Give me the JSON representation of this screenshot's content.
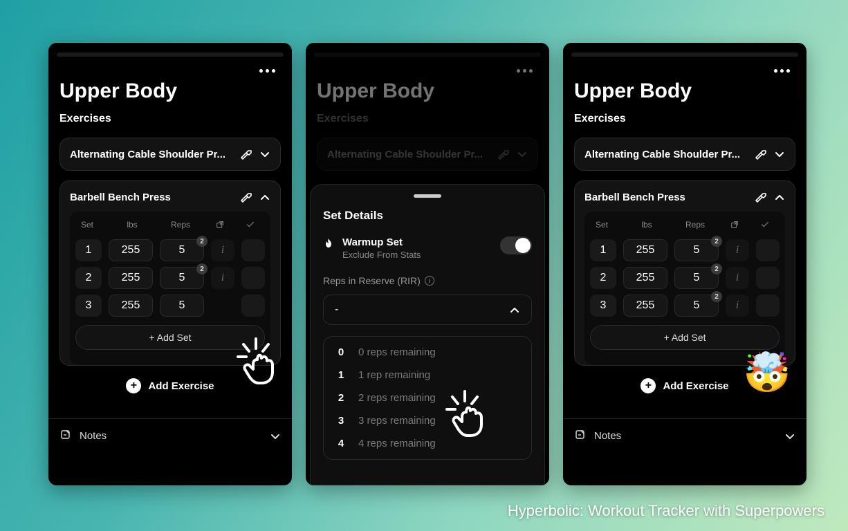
{
  "caption": "Hyperbolic: Workout Tracker with Superpowers",
  "common": {
    "title": "Upper Body",
    "section_label": "Exercises",
    "exercise1_name": "Alternating Cable Shoulder Pr...",
    "exercise2_name": "Barbell Bench Press",
    "headers": {
      "set": "Set",
      "lbs": "lbs",
      "reps": "Reps"
    },
    "add_set": "+ Add Set",
    "add_exercise": "Add Exercise",
    "notes": "Notes"
  },
  "phone1": {
    "sets": [
      {
        "n": "1",
        "lbs": "255",
        "reps": "5",
        "badge": "2"
      },
      {
        "n": "2",
        "lbs": "255",
        "reps": "5",
        "badge": "2"
      },
      {
        "n": "3",
        "lbs": "255",
        "reps": "5"
      }
    ]
  },
  "phone2": {
    "sheet_title": "Set Details",
    "warmup_title": "Warmup Set",
    "warmup_sub": "Exclude From Stats",
    "rir_label": "Reps in Reserve (RIR)",
    "select_value": "-",
    "options": [
      {
        "num": "0",
        "desc": "0 reps remaining"
      },
      {
        "num": "1",
        "desc": "1 rep remaining"
      },
      {
        "num": "2",
        "desc": "2 reps remaining"
      },
      {
        "num": "3",
        "desc": "3 reps remaining"
      },
      {
        "num": "4",
        "desc": "4 reps remaining"
      }
    ]
  },
  "phone3": {
    "sets": [
      {
        "n": "1",
        "lbs": "255",
        "reps": "5",
        "badge": "2"
      },
      {
        "n": "2",
        "lbs": "255",
        "reps": "5",
        "badge": "2"
      },
      {
        "n": "3",
        "lbs": "255",
        "reps": "5",
        "badge": "2"
      }
    ]
  }
}
